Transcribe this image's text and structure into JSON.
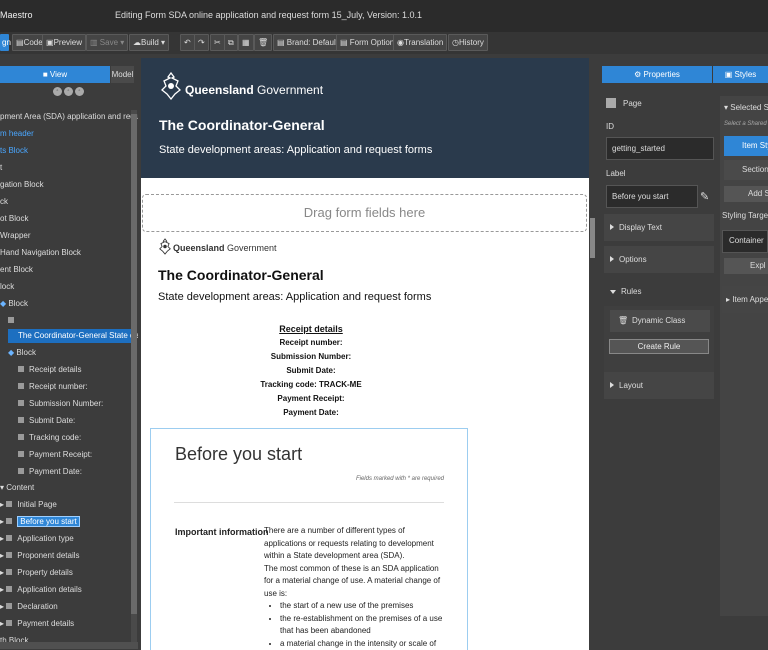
{
  "titlebar": {
    "app": "Maestro",
    "title": "Editing Form SDA online application and request form 15_July, Version: 1.0.1"
  },
  "toolbar": {
    "design": "gn",
    "code": "Code",
    "preview": "Preview",
    "save": "Save",
    "build": "Build",
    "brand": "Brand: Default",
    "form_options": "Form Options",
    "translation": "Translation",
    "history": "History"
  },
  "left": {
    "tab_view": "View",
    "tab_model": "Model",
    "tree": [
      "pment Area (SDA) application and request",
      "m header",
      "ts Block",
      "t",
      "gation Block",
      "ck",
      "ot Block",
      "Wrapper",
      "Hand Navigation Block",
      "ent Block",
      "lock",
      "Block",
      "The Coordinator-General State develo",
      "Block",
      "Receipt details",
      "Receipt number:",
      "Submission Number:",
      "Submit Date:",
      "Tracking code:",
      "Payment Receipt:",
      "Payment Date:",
      "Content",
      "Initial Page",
      "Before you start",
      "Application type",
      "Proponent details",
      "Property details",
      "Application details",
      "Declaration",
      "Payment details",
      "th Block"
    ]
  },
  "hero": {
    "brand_bold": "Queensland",
    "brand_rest": " Government",
    "title": "The Coordinator-General",
    "subtitle": "State development areas: Application and request forms"
  },
  "dropzone": "Drag form fields here",
  "form": {
    "brand_bold": "Queensland",
    "brand_rest": " Government",
    "title": "The Coordinator-General",
    "subtitle": "State development areas: Application and request forms",
    "receipt": {
      "heading": "Receipt details",
      "rows": [
        "Receipt number:",
        "Submission Number:",
        "Submit Date:",
        "Tracking code: TRACK-ME",
        "Payment Receipt:",
        "Payment Date:"
      ]
    },
    "card": {
      "title": "Before you start",
      "fields_note": "Fields marked with * are required",
      "important_label": "Important information",
      "para1": "There are a number of different types of applications or requests relating to development within a State development area (SDA).",
      "para2": "The most common of these is an SDA application for a material change of use. A material change of use is:",
      "bullets": [
        "the start of a new use of the premises",
        "the re-establishment on the premises of a use that has been abandoned",
        "a material change in the intensity or scale of the use of"
      ]
    }
  },
  "right": {
    "tab_properties": "Properties",
    "tab_styles": "Styles",
    "type": "Page",
    "id_label": "ID",
    "id_value": "getting_started",
    "label_label": "Label",
    "label_value": "Before you start",
    "sections": [
      "Display Text",
      "Options",
      "Rules",
      "Layout"
    ],
    "dynamic_class": "Dynamic Class",
    "create_rule": "Create Rule",
    "styles": {
      "selected": "Selected S",
      "select_shared": "Select a Shared Sty",
      "item_style": "Item Sty",
      "section": "Section",
      "add": "Add S",
      "styling_target": "Styling Target",
      "container": "Container",
      "expl": "Expl",
      "item_appear": "Item Appea"
    }
  },
  "colors": {
    "accent": "#2f86d6",
    "hero_bg": "#2a3a4c",
    "panel_bg": "#3c3c3c"
  }
}
